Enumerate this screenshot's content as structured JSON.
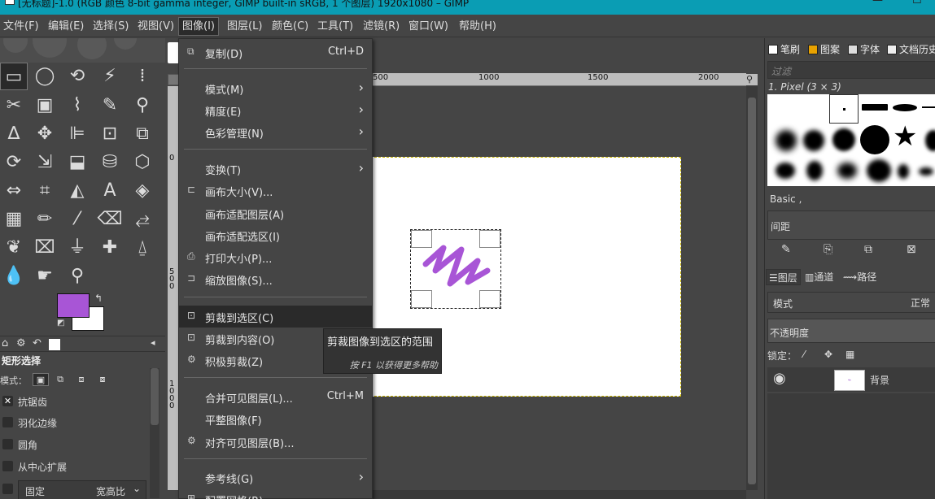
{
  "title_bar": {
    "text": "[无标题]-1.0 (RGB 颜色 8-bit gamma integer, GIMP built-in sRGB, 1 个图层) 1920x1080 – GIMP",
    "minimize": "—",
    "maximize": "☐"
  },
  "menubar": [
    {
      "label": "文件(F)"
    },
    {
      "label": "编辑(E)"
    },
    {
      "label": "选择(S)"
    },
    {
      "label": "视图(V)"
    },
    {
      "label": "图像(I)"
    },
    {
      "label": "图层(L)"
    },
    {
      "label": "颜色(C)"
    },
    {
      "label": "工具(T)"
    },
    {
      "label": "滤镜(R)"
    },
    {
      "label": "窗口(W)"
    },
    {
      "label": "帮助(H)"
    }
  ],
  "image_menu": {
    "duplicate": {
      "label": "复制(D)",
      "shortcut": "Ctrl+D"
    },
    "mode": "模式(M)",
    "precision": "精度(E)",
    "color_management": "色彩管理(N)",
    "transform": "变换(T)",
    "canvas_size": "画布大小(V)...",
    "fit_canvas_layers": "画布适配图层(A)",
    "fit_canvas_selection": "画布适配选区(I)",
    "print_size": "打印大小(P)...",
    "scale_image": "缩放图像(S)...",
    "crop_to_selection": "剪裁到选区(C)",
    "crop_to_content": "剪裁到内容(O)",
    "zealous_crop": "积极剪裁(Z)",
    "merge_visible": {
      "label": "合并可见图层(L)...",
      "shortcut": "Ctrl+M"
    },
    "flatten": "平整图像(F)",
    "align_visible": "对齐可见图层(B)...",
    "guides": "参考线(G)",
    "configure_grid": "配置网格(R)..."
  },
  "tooltip": {
    "title": "剪裁图像到选区的范围",
    "hint": "按 F1 以获得更多帮助"
  },
  "ruler": {
    "h_ticks": [
      "500",
      "1000",
      "1500",
      "2000"
    ],
    "v_labels": [
      "0",
      "5\n0\n0",
      "1\n0\n0\n0"
    ]
  },
  "toolbox": {
    "tool_options_title": "矩形选择",
    "mode_label": "模式：",
    "antialias": "抗锯齿",
    "feather": "羽化边缘",
    "rounded": "圆角",
    "expand_center": "从中心扩展",
    "fixed": "固定",
    "fixed_value": "宽高比",
    "fg_color": "#a855d6",
    "bg_color": "#ffffff"
  },
  "brushes_dock": {
    "tabs": [
      "笔刷",
      "图案",
      "字体",
      "文档历史"
    ],
    "filter_placeholder": "过滤",
    "current_brush": "1. Pixel (3 × 3)",
    "tag": "Basic ,",
    "spacing_label": "间距"
  },
  "layers_dock": {
    "tabs": [
      "图层",
      "通道",
      "路径"
    ],
    "mode_label": "模式",
    "mode_value": "正常",
    "opacity_label": "不透明度",
    "lock_label": "锁定：",
    "layer_name": "背景"
  }
}
